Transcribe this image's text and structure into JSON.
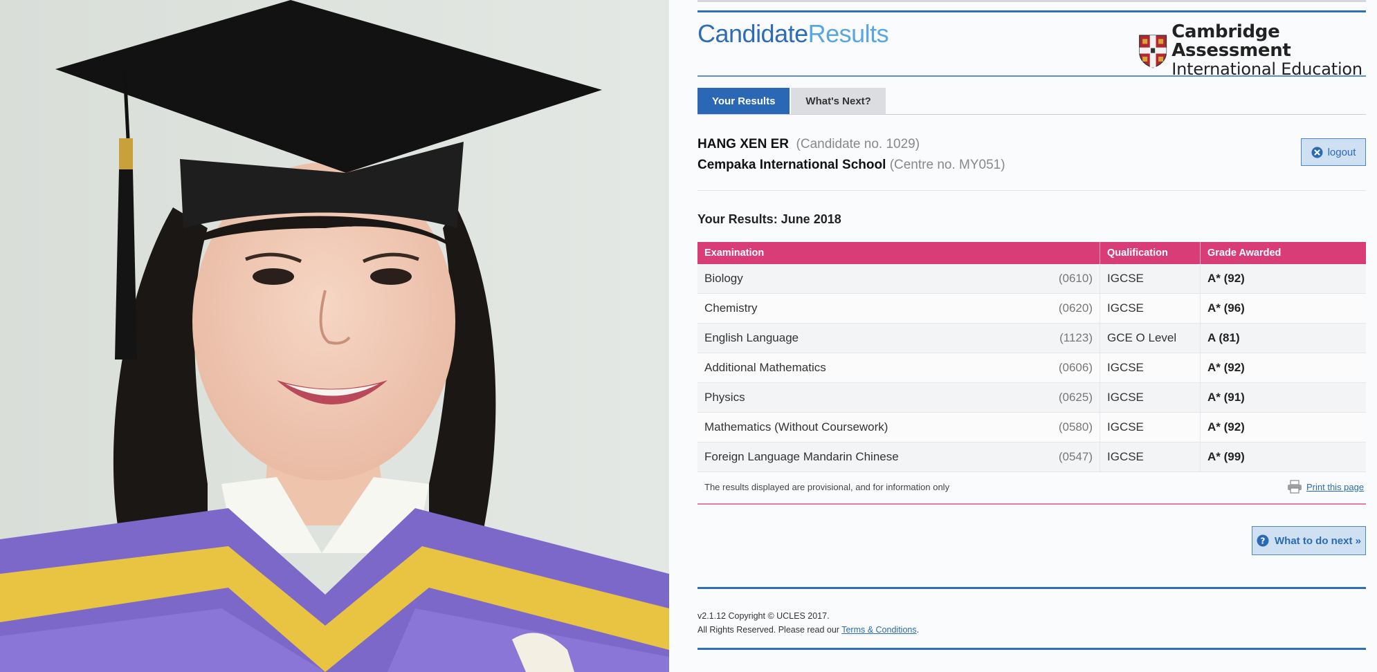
{
  "brand": {
    "part1": "Candidate",
    "part2": "Results"
  },
  "org": {
    "line1": "Cambridge Assessment",
    "line2": "International Education"
  },
  "tabs": [
    {
      "label": "Your Results"
    },
    {
      "label": "What's Next?"
    }
  ],
  "candidate": {
    "name": "HANG XEN ER",
    "number": "(Candidate no. 1029)",
    "school": "Cempaka International School",
    "centre": "(Centre no. MY051)"
  },
  "logout_label": "logout",
  "results_title": "Your Results: June 2018",
  "table": {
    "headers": [
      "Examination",
      "Qualification",
      "Grade Awarded"
    ],
    "rows": [
      {
        "exam": "Biology",
        "code": "(0610)",
        "qual": "IGCSE",
        "grade": "A* (92)"
      },
      {
        "exam": "Chemistry",
        "code": "(0620)",
        "qual": "IGCSE",
        "grade": "A* (96)"
      },
      {
        "exam": "English Language",
        "code": "(1123)",
        "qual": "GCE O Level",
        "grade": "A (81)"
      },
      {
        "exam": "Additional Mathematics",
        "code": "(0606)",
        "qual": "IGCSE",
        "grade": "A* (92)"
      },
      {
        "exam": "Physics",
        "code": "(0625)",
        "qual": "IGCSE",
        "grade": "A* (91)"
      },
      {
        "exam": "Mathematics (Without Coursework)",
        "code": "(0580)",
        "qual": "IGCSE",
        "grade": "A* (92)"
      },
      {
        "exam": "Foreign Language Mandarin Chinese",
        "code": "(0547)",
        "qual": "IGCSE",
        "grade": "A* (99)"
      }
    ]
  },
  "disclaimer": "The results displayed are provisional, and for information only",
  "print_label": "Print this page",
  "next_label": "What to do next »",
  "footer": {
    "line1": "v2.1.12 Copyright © UCLES 2017.",
    "line2_prefix": "All Rights Reserved. Please read our ",
    "terms_link": "Terms & Conditions",
    "line2_suffix": "."
  },
  "colors": {
    "tab_active": "#2a68b6",
    "table_header": "#d93d78",
    "brand_blue": "#2d6db7",
    "brand_light": "#5aa6e0"
  },
  "icons": [
    "crest-icon",
    "close-circle-icon",
    "printer-icon",
    "question-circle-icon"
  ]
}
